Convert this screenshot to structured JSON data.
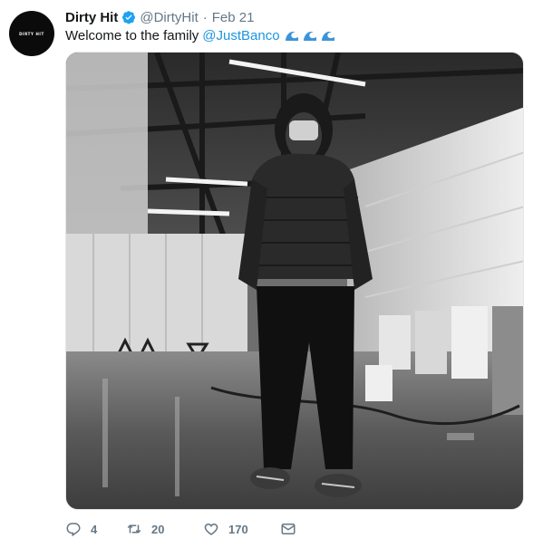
{
  "tweet": {
    "author_name": "Dirty Hit",
    "author_handle": "@DirtyHit",
    "separator": "·",
    "timestamp": "Feb 21",
    "avatar_text": "DIRTY HIT",
    "text": "Welcome to the family",
    "mention": "@JustBanco",
    "emoji": [
      "wave-emoji",
      "wave-emoji",
      "wave-emoji"
    ]
  },
  "media": {
    "description_icon": "photo"
  },
  "actions": {
    "reply_count": "4",
    "retweet_count": "20",
    "like_count": "170"
  },
  "colors": {
    "text": "#14171a",
    "secondary": "#657786",
    "link": "#1b95e0",
    "verified": "#1da1f2"
  }
}
